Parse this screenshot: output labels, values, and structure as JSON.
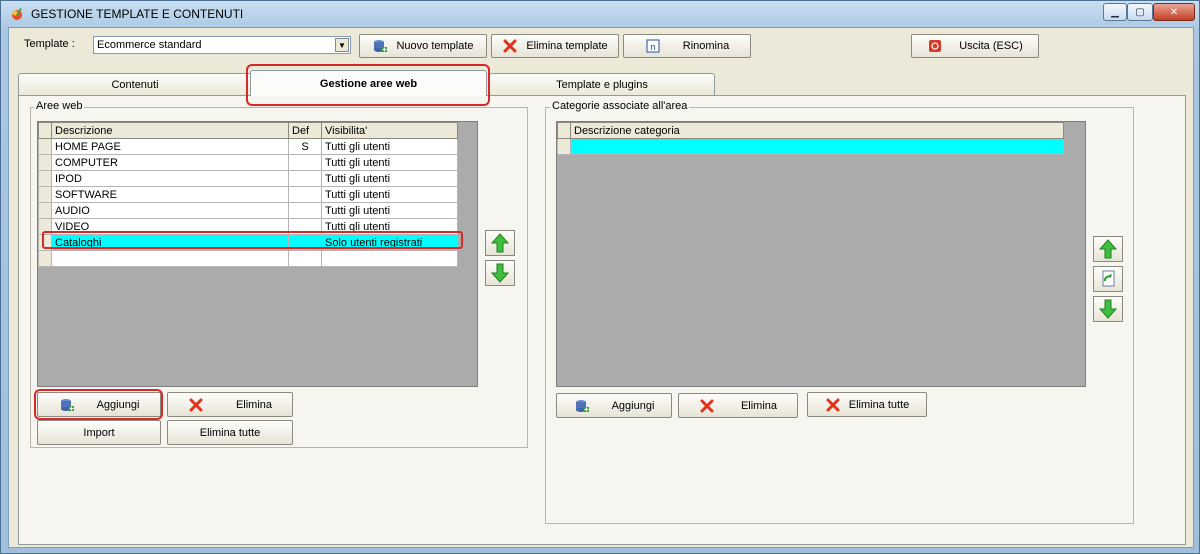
{
  "window": {
    "title": "GESTIONE TEMPLATE E CONTENUTI"
  },
  "toolbar": {
    "template_label": "Template :",
    "template_value": "Ecommerce standard",
    "new_template": "Nuovo template",
    "delete_template": "Elimina template",
    "rename": "Rinomina",
    "exit": "Uscita (ESC)"
  },
  "tabs": [
    {
      "label": "Contenuti"
    },
    {
      "label": "Gestione aree web"
    },
    {
      "label": "Template e plugins"
    }
  ],
  "left_group": {
    "title": "Aree web",
    "columns": [
      "Descrizione",
      "Def",
      "Visibilita'"
    ],
    "rows": [
      {
        "desc": "HOME PAGE",
        "def": "S",
        "vis": "Tutti gli utenti"
      },
      {
        "desc": "COMPUTER",
        "def": "",
        "vis": "Tutti gli utenti"
      },
      {
        "desc": "IPOD",
        "def": "",
        "vis": "Tutti gli utenti"
      },
      {
        "desc": "SOFTWARE",
        "def": "",
        "vis": "Tutti gli utenti"
      },
      {
        "desc": "AUDIO",
        "def": "",
        "vis": "Tutti gli utenti"
      },
      {
        "desc": "VIDEO",
        "def": "",
        "vis": "Tutti gli utenti"
      },
      {
        "desc": "Cataloghi",
        "def": "",
        "vis": "Solo utenti registrati"
      }
    ],
    "add": "Aggiungi",
    "delete": "Elimina",
    "import": "Import",
    "delete_all": "Elimina tutte"
  },
  "right_group": {
    "title": "Categorie associate all'area",
    "columns": [
      "Descrizione categoria"
    ],
    "add": "Aggiungi",
    "delete": "Elimina",
    "delete_all": "Elimina tutte"
  },
  "colors": {
    "selection": "#00ffff",
    "highlight": "#d42a2a",
    "grid_bg": "#ababab"
  }
}
